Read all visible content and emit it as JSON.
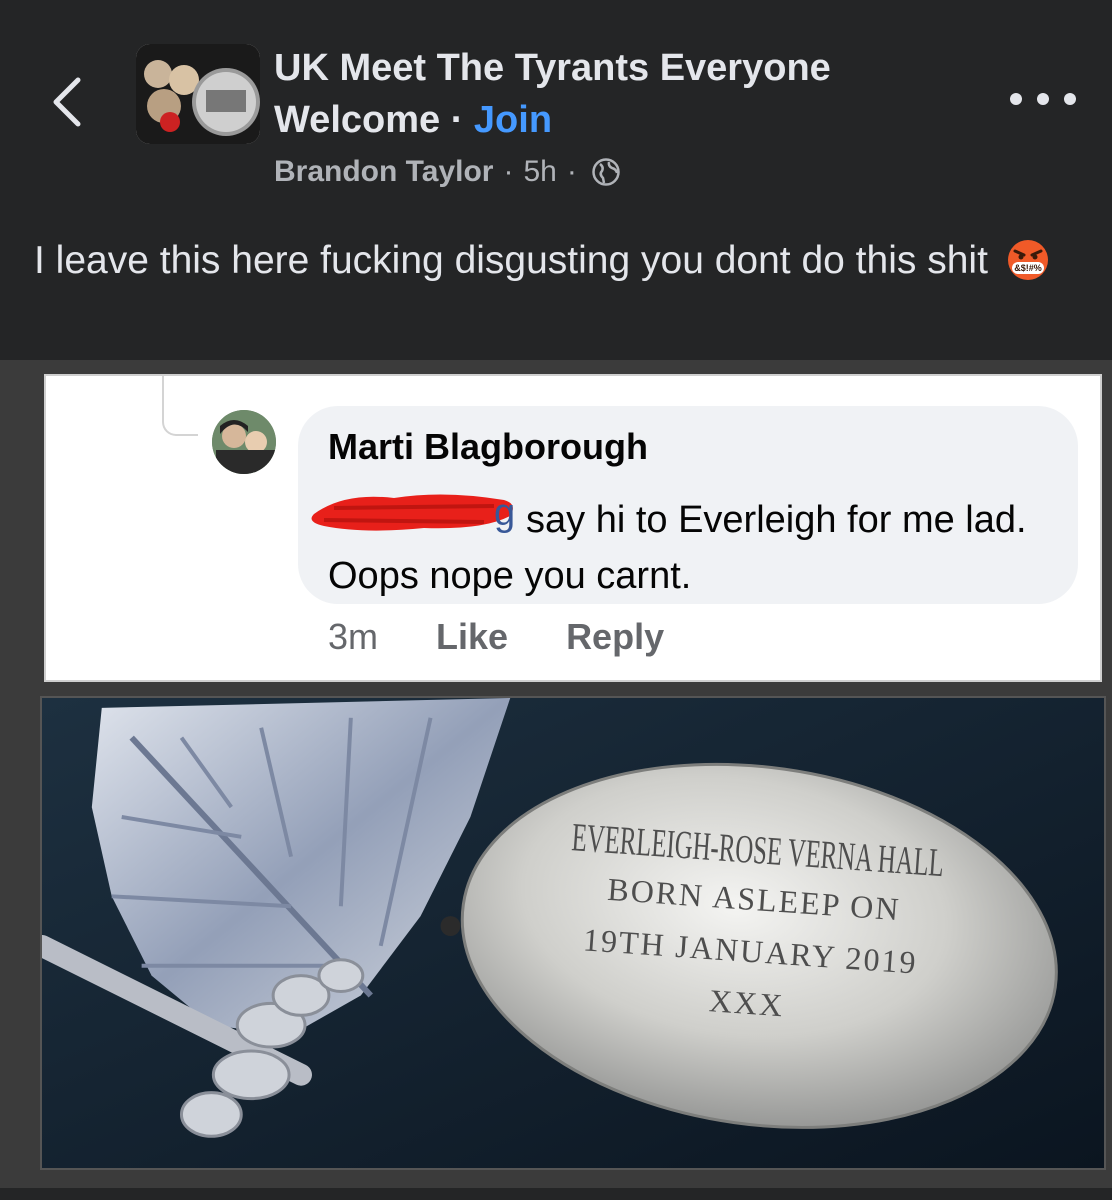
{
  "header": {
    "group_name": "UK Meet The Tyrants Everyone Welcome",
    "separator": "·",
    "join_label": "Join",
    "author": "Brandon Taylor",
    "time": "5h",
    "meta_separator": "·",
    "icons": {
      "back": "chevron-left-icon",
      "privacy": "globe-icon",
      "more": "more-options-icon"
    }
  },
  "post": {
    "text": "I leave this here fucking disgusting you dont do this shit",
    "emoji": "face-with-symbols-on-mouth",
    "emoji_text": "&$!#%"
  },
  "shared_comment": {
    "author": "Marti Blagborough",
    "tag_tail": "g",
    "body": "say hi to Everleigh for me lad. Oops nope you carnt.",
    "timestamp": "3m",
    "like_label": "Like",
    "reply_label": "Reply"
  },
  "engraving": {
    "line1": "EVERLEIGH-ROSE VERNA HALL",
    "line2": "BORN ASLEEP ON",
    "line3": "19TH JANUARY 2019",
    "line4": "XXX"
  },
  "colors": {
    "background": "#242526",
    "link": "#4599ff",
    "comment_bubble": "#f0f2f5",
    "redaction": "#e8201a"
  }
}
